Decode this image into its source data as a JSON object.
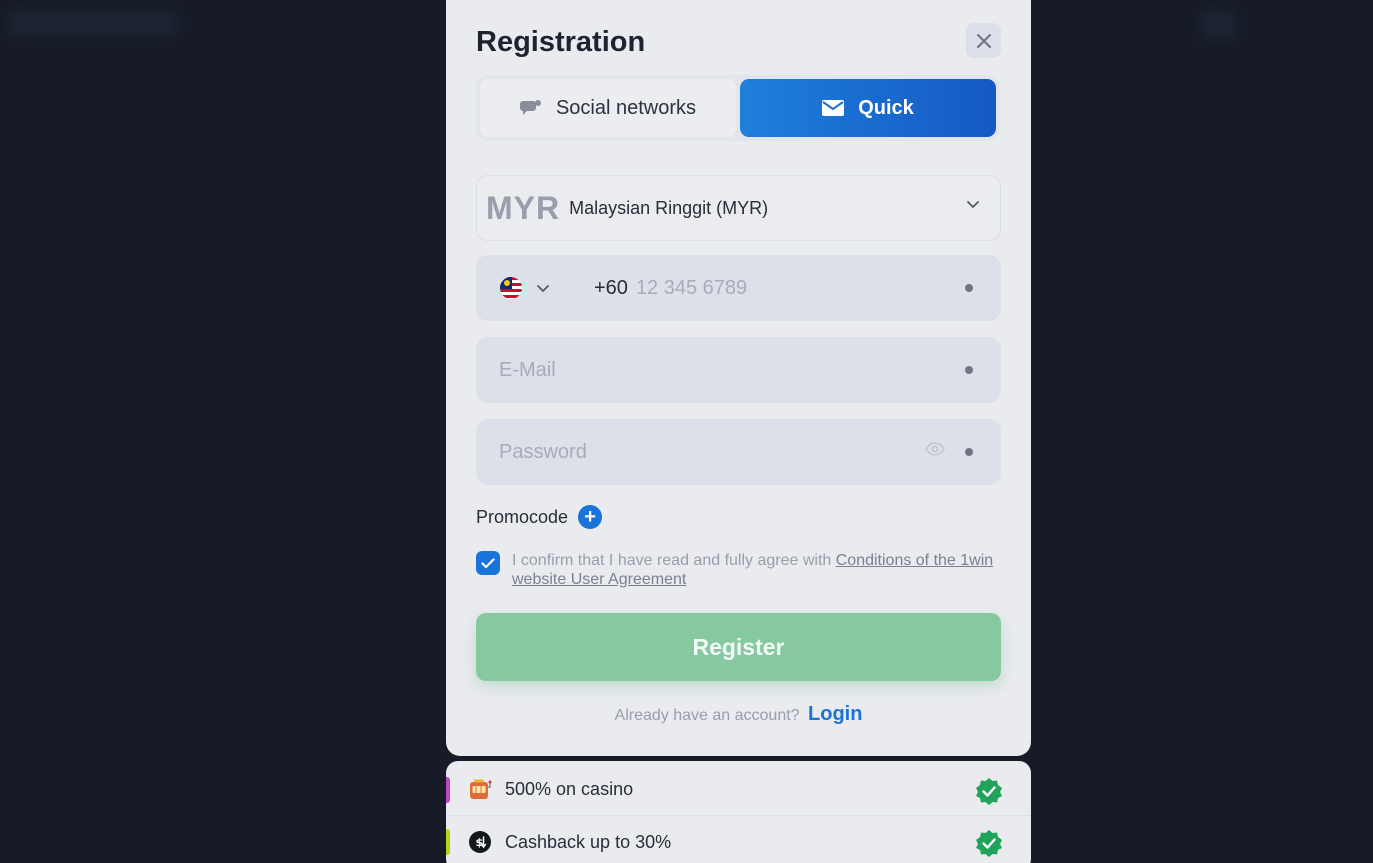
{
  "modal": {
    "title": "Registration",
    "tabs": [
      {
        "label": "Social networks",
        "icon": "chat-bubble-icon",
        "active": false
      },
      {
        "label": "Quick",
        "icon": "envelope-icon",
        "active": true
      }
    ],
    "currency": {
      "code": "MYR",
      "name": "Malaysian Ringgit (MYR)"
    },
    "phone": {
      "country_flag": "malaysia-flag-icon",
      "dial_code": "+60",
      "placeholder": "12 345 6789"
    },
    "email": {
      "placeholder": "E-Mail"
    },
    "password": {
      "placeholder": "Password"
    },
    "promocode_label": "Promocode",
    "agreement": {
      "checked": true,
      "text": "I confirm that I have read and fully agree with ",
      "link": "Conditions of the 1win website User Agreement"
    },
    "register_label": "Register",
    "login_question": "Already have an account?",
    "login_label": "Login"
  },
  "bonuses": [
    {
      "text": "500% on casino",
      "icon": "slot-machine-icon",
      "bar_color": "#c445c4"
    },
    {
      "text": "Cashback up to 30%",
      "icon": "cashback-icon",
      "bar_color": "#b7d411"
    }
  ],
  "colors": {
    "accent_blue": "#1a73d9",
    "register_green": "#86c9a0",
    "check_green": "#21a35a",
    "background": "#161b27"
  }
}
